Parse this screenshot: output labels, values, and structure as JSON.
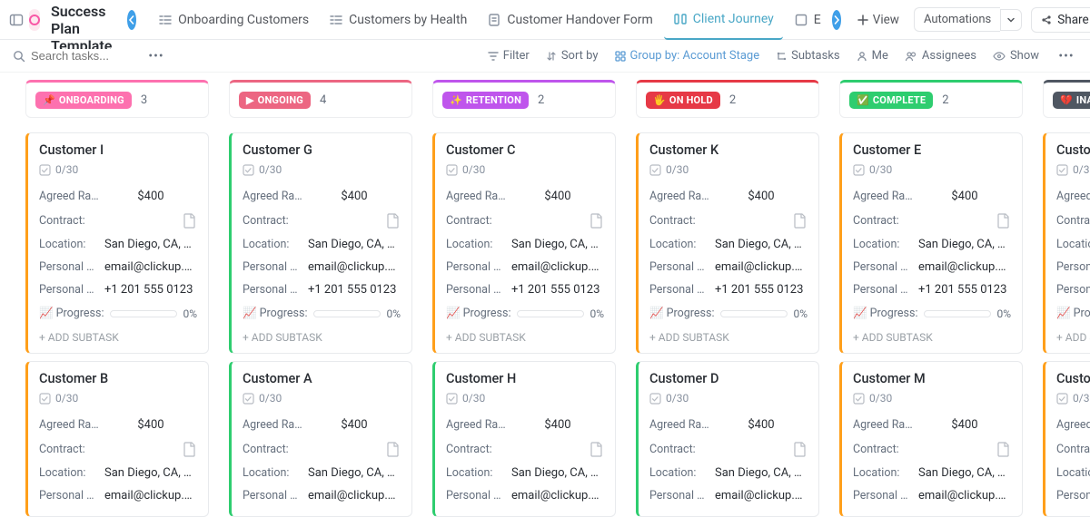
{
  "header": {
    "title": "Customer Success Plan Template",
    "tabs": [
      {
        "label": "Onboarding Customers",
        "active": false
      },
      {
        "label": "Customers by Health",
        "active": false
      },
      {
        "label": "Customer Handover Form",
        "active": false
      },
      {
        "label": "Client Journey",
        "active": true
      },
      {
        "label": "E",
        "active": false,
        "truncated": true
      }
    ],
    "view_label": "View",
    "automations_label": "Automations",
    "share_label": "Share"
  },
  "controls": {
    "search_placeholder": "Search tasks...",
    "filter": "Filter",
    "sort": "Sort by",
    "group": "Group by: Account Stage",
    "subtasks": "Subtasks",
    "me": "Me",
    "assignees": "Assignees",
    "show": "Show"
  },
  "field_labels": {
    "rate": "Agreed Rat...",
    "contract": "Contract:",
    "location": "Location:",
    "email": "Personal E...",
    "phone": "Personal N...",
    "progress": "📈 Progress:",
    "add_subtask": "+ ADD SUBTASK",
    "subprogress": "0/30"
  },
  "shared_card": {
    "rate": "$400",
    "location": "San Diego, CA, U...",
    "email": "email@clickup.com",
    "phone": "+1 201 555 0123",
    "progress_pct": "0%"
  },
  "columns": [
    {
      "stage": "ONBOARDING",
      "emoji": "📌",
      "count": "3",
      "color": "#fd71af",
      "cards": [
        {
          "title": "Customer I",
          "accent": "#ff9f1a"
        },
        {
          "title": "Customer B",
          "accent": "#ff9f1a"
        }
      ]
    },
    {
      "stage": "ONGOING",
      "emoji": "▶",
      "count": "4",
      "color": "#ec6682",
      "cards": [
        {
          "title": "Customer G",
          "accent": "#2ecd6f"
        },
        {
          "title": "Customer A",
          "accent": "#2ecd6f"
        }
      ]
    },
    {
      "stage": "RETENTION",
      "emoji": "✨",
      "count": "2",
      "color": "#bf55ec",
      "cards": [
        {
          "title": "Customer C",
          "accent": "#ff9f1a"
        },
        {
          "title": "Customer H",
          "accent": "#2ecd6f"
        }
      ]
    },
    {
      "stage": "ON HOLD",
      "emoji": "🖐",
      "count": "2",
      "color": "#e63946",
      "cards": [
        {
          "title": "Customer K",
          "accent": "#ff9f1a"
        },
        {
          "title": "Customer D",
          "accent": "#2ecd6f"
        }
      ]
    },
    {
      "stage": "COMPLETE",
      "emoji": "✅",
      "count": "2",
      "color": "#2ecd6f",
      "cards": [
        {
          "title": "Customer E",
          "accent": "#ff9f1a"
        },
        {
          "title": "Customer M",
          "accent": "#ff9f1a"
        }
      ]
    },
    {
      "stage": "INACTI",
      "emoji": "💔",
      "count": "",
      "color": "#4f5762",
      "cards": [
        {
          "title": "Custome",
          "accent": "#ff9f1a"
        },
        {
          "title": "Custome",
          "accent": "#ff9f1a"
        }
      ]
    }
  ]
}
